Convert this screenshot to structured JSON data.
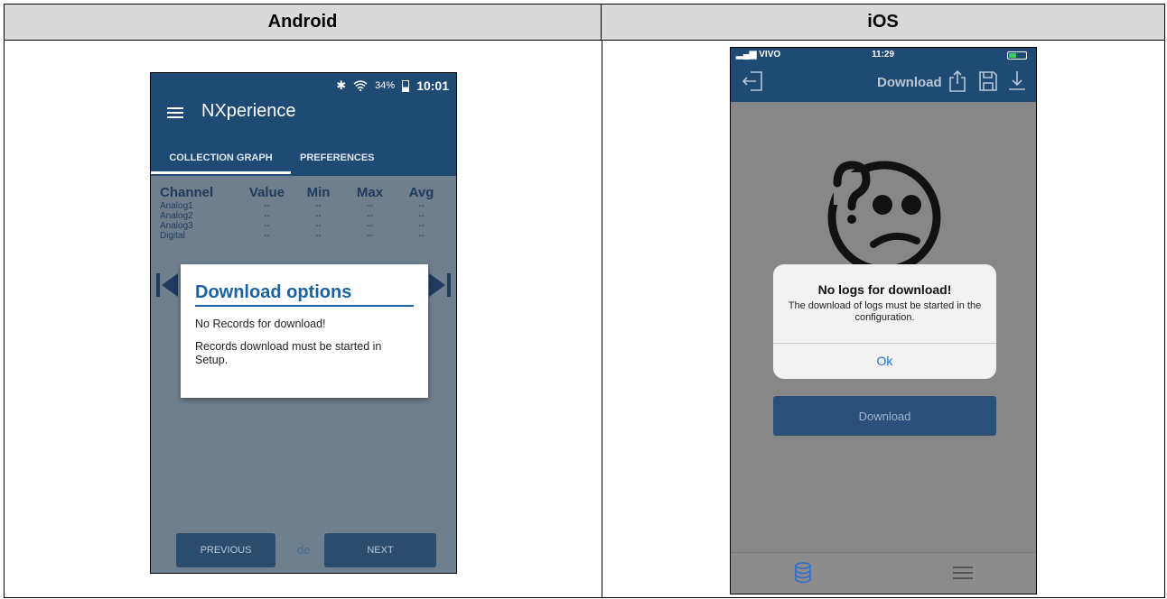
{
  "headers": {
    "android": "Android",
    "ios": "iOS"
  },
  "android": {
    "status": {
      "pct": "34%",
      "time": "10:01"
    },
    "app_title": "NXperience",
    "tabs": [
      "COLLECTION GRAPH",
      "PREFERENCES"
    ],
    "table": {
      "headers": [
        "Channel",
        "Value",
        "Min",
        "Max",
        "Avg"
      ],
      "rows": [
        [
          "Analog1",
          "--",
          "--",
          "--",
          "--"
        ],
        [
          "Analog2",
          "--",
          "--",
          "--",
          "--"
        ],
        [
          "Analog3",
          "--",
          "--",
          "--",
          "--"
        ],
        [
          "Digital",
          "--",
          "--",
          "--",
          "--"
        ]
      ]
    },
    "dialog": {
      "title": "Download options",
      "line1": "No Records for download!",
      "line2": "Records download must be started in Setup."
    },
    "footer": {
      "previous": "PREVIOUS",
      "de": "de",
      "next": "NEXT"
    }
  },
  "ios": {
    "status": {
      "carrier": "VIVO",
      "time": "11:29"
    },
    "nav_title": "Download",
    "icons": [
      "exit-icon",
      "share-icon",
      "save-icon",
      "download-icon"
    ],
    "alert": {
      "title": "No logs for download!",
      "message": "The download of logs must be started in the configuration.",
      "ok": "Ok"
    },
    "download_button": "Download",
    "tabbar_icons": [
      "database-icon",
      "menu-icon"
    ]
  },
  "colors": {
    "android_bar": "#1f4a74",
    "dialog_title": "#1b62a3",
    "ios_ok": "#1a6fd6"
  }
}
